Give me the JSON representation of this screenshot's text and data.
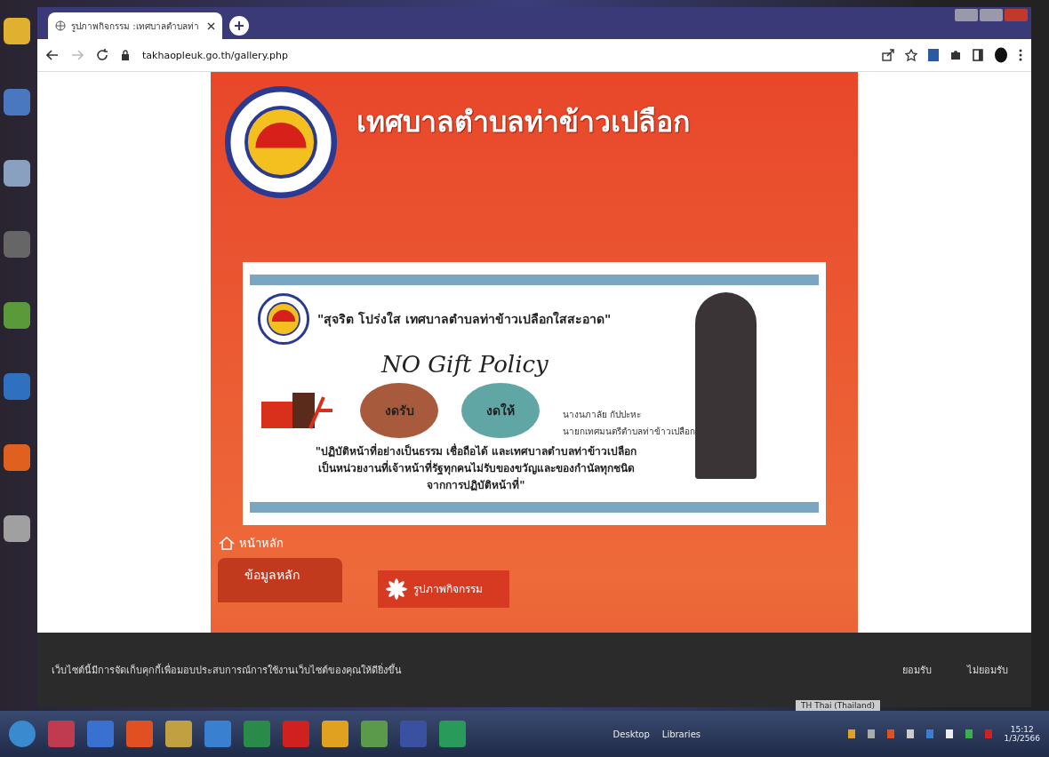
{
  "browser": {
    "tab": {
      "title": "รูปภาพกิจกรรม :เทศบาลตำบลท่า",
      "selected": true
    },
    "url": "takhaopleuk.go.th/gallery.php"
  },
  "site": {
    "title": "เทศบาลตำบลท่าข้าวเปลือก",
    "banner": {
      "slogan": "\"สุจริต โปร่งใส เทศบาลตำบลท่าข้าวเปลือกใสสะอาด\"",
      "policy": "NO Gift Policy",
      "badges": [
        {
          "label": "งดรับ",
          "color": "#a85a3c"
        },
        {
          "label": "งดให้",
          "color": "#5fa6a4"
        }
      ],
      "person_name": "นางนภาลัย กัปปะหะ",
      "person_role": "นายกเทศมนตรีตำบลท่าข้าวเปลือก",
      "quote": "\"ปฏิบัติหน้าที่อย่างเป็นธรรม เชื่อถือได้ และเทศบาลตำบลท่าข้าวเปลือก\nเป็นหน่วยงานที่เจ้าหน้าที่รัฐทุกคนไม่รับของขวัญและของกำนัลทุกชนิด\nจากการปฏิบัติหน้าที่\""
    },
    "home_link": "หน้าหลัก",
    "menu_title": "ข้อมูลหลัก",
    "section_title": "รูปภาพกิจกรรม"
  },
  "cookie_banner": {
    "message": "เว็บไซต์นี้มีการจัดเก็บคุกกี้เพื่อมอบประสบการณ์การใช้งานเว็บไซต์ของคุณให้ดียิ่งขึ้น",
    "buttons": [
      "ยอมรับ",
      "ไม่ยอมรับ"
    ]
  },
  "taskbar": {
    "toolbar_labels": [
      "Desktop",
      "Libraries"
    ],
    "language": "TH Thai (Thailand)",
    "time": "15:12",
    "date": "1/3/2566"
  }
}
